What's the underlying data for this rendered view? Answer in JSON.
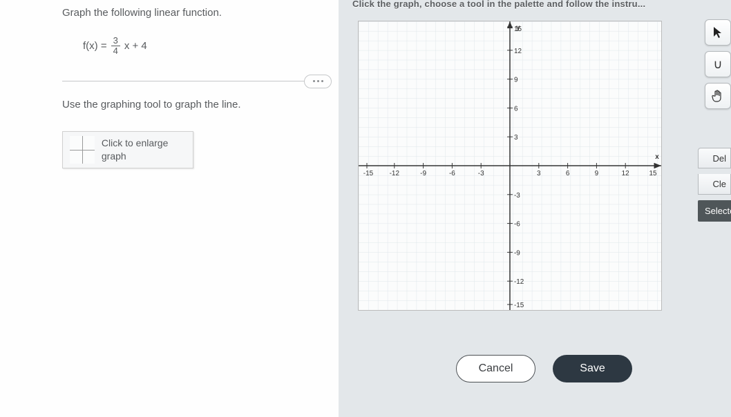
{
  "problem": {
    "title": "Graph the following linear function.",
    "fx_prefix": "f(x) =",
    "frac_num": "3",
    "frac_den": "4",
    "fx_suffix": "x + 4",
    "instruction": "Use the graphing tool to graph the line.",
    "enlarge_text": "Click to enlarge graph"
  },
  "top_hint": "Click the graph, choose a tool in the palette and follow the instru...",
  "axes": {
    "x_label": "x",
    "y_label": "y",
    "ticks_pos": [
      "3",
      "6",
      "9",
      "12",
      "15"
    ],
    "ticks_neg": [
      "-3",
      "-6",
      "-9",
      "-12",
      "-15"
    ]
  },
  "palette": {
    "pointer": "▲",
    "undo": "∪",
    "hand": "✋",
    "delete": "Del",
    "clear": "Cle",
    "selected": "Selected"
  },
  "buttons": {
    "cancel": "Cancel",
    "save": "Save"
  }
}
